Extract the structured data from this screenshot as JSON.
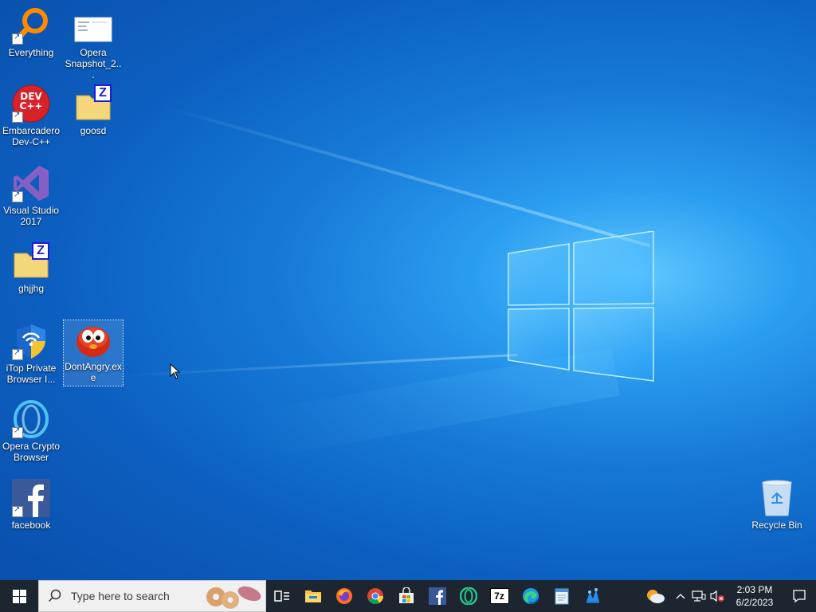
{
  "desktop": {
    "icons": [
      {
        "label": "Everything",
        "name": "desktop-icon-everything"
      },
      {
        "label": "Opera Snapshot_2...",
        "name": "desktop-icon-opera-snapshot"
      },
      {
        "label": "Embarcadero Dev-C++",
        "name": "desktop-icon-devcpp"
      },
      {
        "label": "goosd",
        "name": "desktop-icon-goosd"
      },
      {
        "label": "Visual Studio 2017",
        "name": "desktop-icon-visual-studio"
      },
      {
        "label": "ghjjhg",
        "name": "desktop-icon-ghjjhg"
      },
      {
        "label": "iTop Private Browser I...",
        "name": "desktop-icon-itop-browser"
      },
      {
        "label": "DontAngry.exe",
        "name": "desktop-icon-dontangry"
      },
      {
        "label": "Opera Crypto Browser",
        "name": "desktop-icon-opera-crypto"
      },
      {
        "label": "facebook",
        "name": "desktop-icon-facebook"
      },
      {
        "label": "Recycle Bin",
        "name": "desktop-icon-recycle-bin"
      }
    ],
    "devcpp_logo_text": "DEV C++",
    "zip_letter": "Z"
  },
  "taskbar": {
    "search_placeholder": "Type here to search",
    "pinned": [
      "task-view-icon",
      "file-explorer-icon",
      "firefox-icon",
      "chrome-icon",
      "microsoft-store-icon",
      "facebook-icon",
      "opera-icon",
      "7zip-icon",
      "edge-icon",
      "notepad-icon",
      "app-icon"
    ],
    "sevenzip_text": "7z",
    "clock_time": "2:03 PM",
    "clock_date": "6/2/2023"
  },
  "colors": {
    "taskbar": "#1c2530",
    "desktop_accent": "#1679d6",
    "running_indicator": "#76b9ed"
  }
}
